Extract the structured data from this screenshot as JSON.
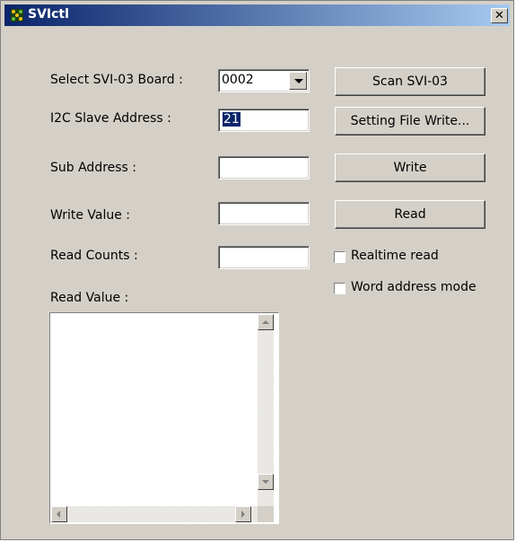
{
  "window": {
    "title": "SVIctl",
    "close_glyph": "✕",
    "app_icon": "svictl-app-icon"
  },
  "form": {
    "board_label": "Select SVI-03 Board :",
    "board_value": "0002",
    "slave_label": "I2C Slave Address :",
    "slave_value": "21",
    "sub_label": "Sub Address :",
    "sub_value": "",
    "write_label": "Write Value :",
    "write_value": "",
    "counts_label": "Read Counts :",
    "counts_value": "",
    "readval_label": "Read Value :",
    "readval_value": ""
  },
  "buttons": {
    "scan": "Scan SVI-03",
    "setting_file_write": "Setting File Write...",
    "write": "Write",
    "read": "Read"
  },
  "checkboxes": {
    "realtime_read": {
      "label": "Realtime read",
      "checked": false
    },
    "word_address_mode": {
      "label": "Word address mode",
      "checked": false
    }
  },
  "colors": {
    "face": "#d4d0c8",
    "title_start": "#0a246a",
    "title_end": "#a6caf0",
    "selection": "#0a246a"
  }
}
